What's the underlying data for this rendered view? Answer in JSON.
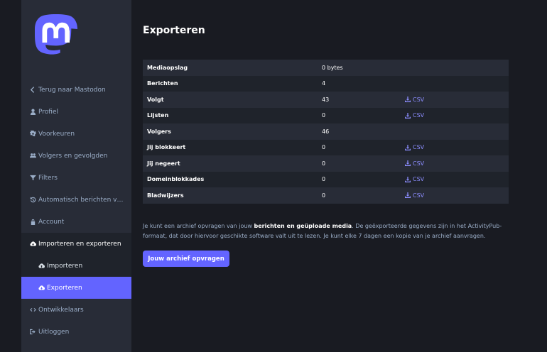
{
  "sidebar": {
    "back": "Terug naar Mastodon",
    "profile": "Profiel",
    "preferences": "Voorkeuren",
    "relationships": "Volgers en gevolgden",
    "filters": "Filters",
    "auto_delete": "Automatisch berichten verwijderen",
    "account": "Account",
    "import_export": "Importeren en exporteren",
    "import": "Importeren",
    "export": "Exporteren",
    "developers": "Ontwikkelaars",
    "logout": "Uitloggen"
  },
  "main": {
    "title": "Exporteren",
    "rows": [
      {
        "label": "Mediaopslag",
        "value": "0 bytes",
        "csv": ""
      },
      {
        "label": "Berichten",
        "value": "4",
        "csv": ""
      },
      {
        "label": "Volgt",
        "value": "43",
        "csv": "CSV"
      },
      {
        "label": "Lijsten",
        "value": "0",
        "csv": "CSV"
      },
      {
        "label": "Volgers",
        "value": "46",
        "csv": ""
      },
      {
        "label": "Jij blokkeert",
        "value": "0",
        "csv": "CSV"
      },
      {
        "label": "Jij negeert",
        "value": "0",
        "csv": "CSV"
      },
      {
        "label": "Domeinblokkades",
        "value": "0",
        "csv": "CSV"
      },
      {
        "label": "Bladwijzers",
        "value": "0",
        "csv": "CSV"
      }
    ],
    "info_pre": "Je kunt een archief opvragen van jouw ",
    "info_strong": "berichten en geüploade media",
    "info_post": ". De geëxporteerde gegevens zijn in het ActivityPub-formaat, dat door hiervoor geschikte software valt uit te lezen. Je kunt elke 7 dagen een kopie van je archief aanvragen.",
    "button": "Jouw archief opvragen"
  },
  "colors": {
    "accent": "#6364ff",
    "link": "#8c8dff",
    "sidebar_bg": "#282c37",
    "page_bg": "#191b22"
  }
}
